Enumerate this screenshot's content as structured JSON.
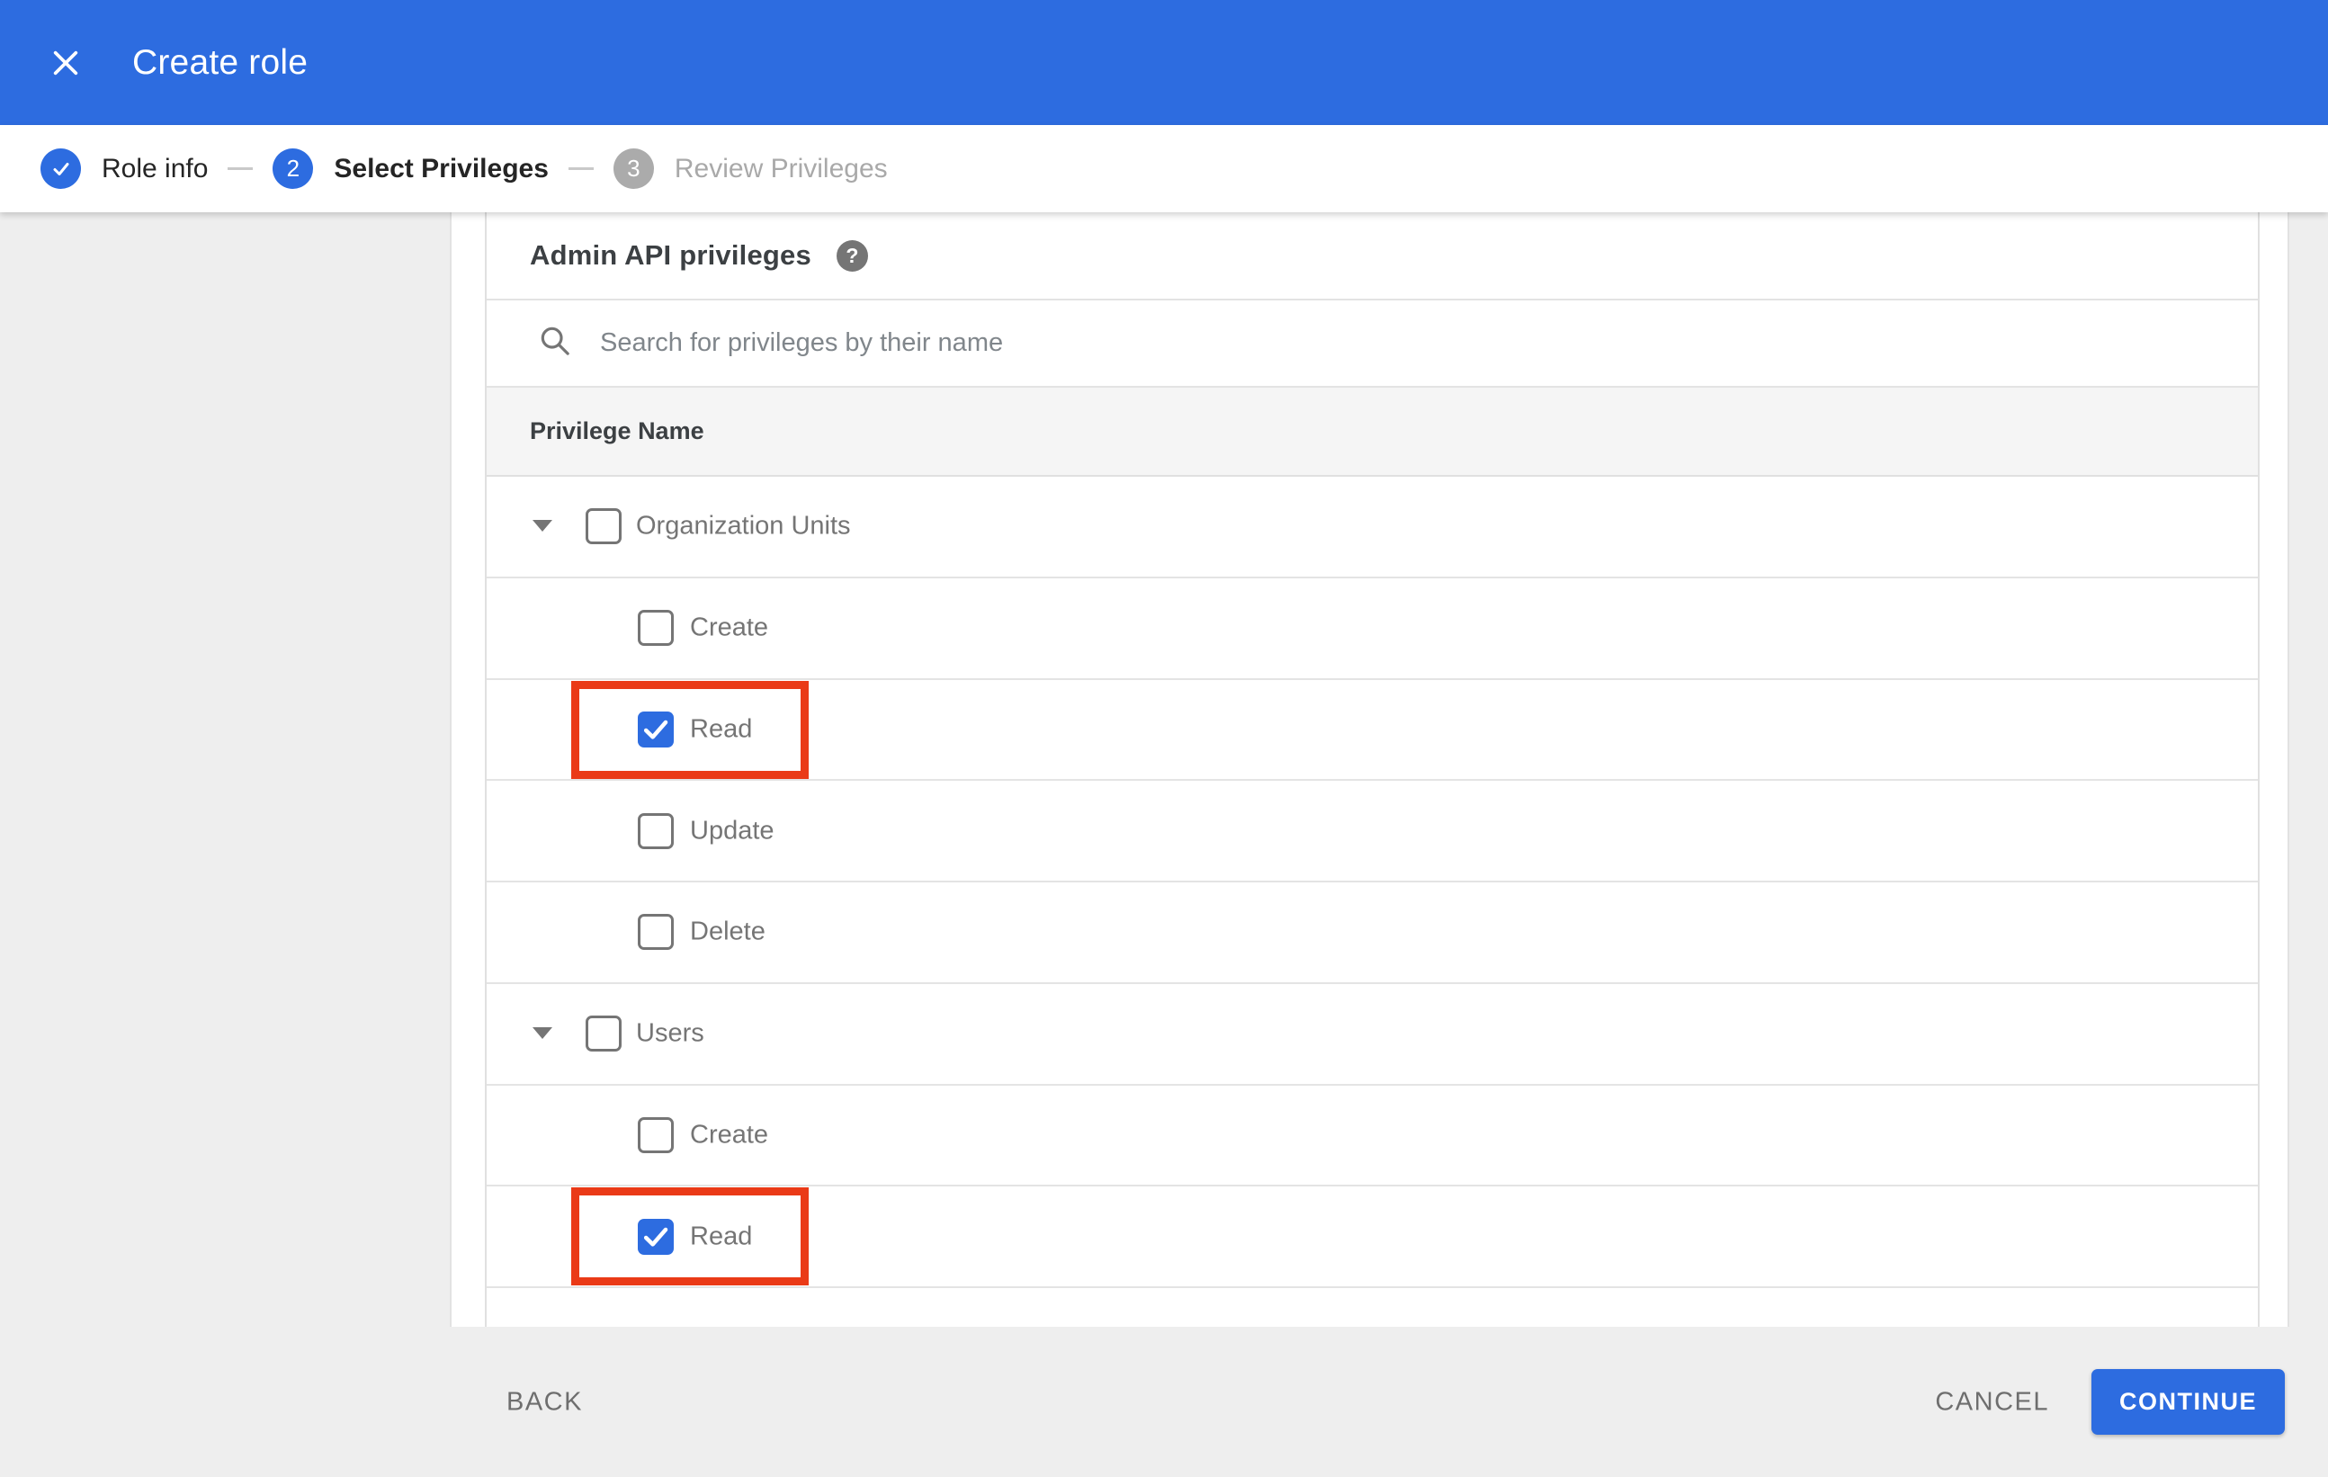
{
  "header": {
    "title": "Create role",
    "close_icon": "x"
  },
  "stepper": {
    "steps": [
      {
        "label": "Role info",
        "state": "complete",
        "indicator": "check"
      },
      {
        "label": "Select Privileges",
        "state": "current",
        "indicator": "2"
      },
      {
        "label": "Review Privileges",
        "state": "upcoming",
        "indicator": "3"
      }
    ]
  },
  "panel": {
    "title": "Admin API privileges",
    "help_glyph": "?",
    "search": {
      "placeholder": "Search for privileges by their name",
      "value": ""
    },
    "table": {
      "header_label": "Privilege Name",
      "rows": [
        {
          "label": "Organization Units",
          "level": 0,
          "expandable": true,
          "expanded": true,
          "checked": false,
          "highlighted": false
        },
        {
          "label": "Create",
          "level": 1,
          "expandable": false,
          "checked": false,
          "highlighted": false
        },
        {
          "label": "Read",
          "level": 1,
          "expandable": false,
          "checked": true,
          "highlighted": true
        },
        {
          "label": "Update",
          "level": 1,
          "expandable": false,
          "checked": false,
          "highlighted": false
        },
        {
          "label": "Delete",
          "level": 1,
          "expandable": false,
          "checked": false,
          "highlighted": false
        },
        {
          "label": "Users",
          "level": 0,
          "expandable": true,
          "expanded": true,
          "checked": false,
          "highlighted": false
        },
        {
          "label": "Create",
          "level": 1,
          "expandable": false,
          "checked": false,
          "highlighted": false
        },
        {
          "label": "Read",
          "level": 1,
          "expandable": false,
          "checked": true,
          "highlighted": true
        }
      ]
    }
  },
  "footer": {
    "back_label": "BACK",
    "cancel_label": "CANCEL",
    "continue_label": "CONTINUE"
  },
  "colors": {
    "header_blue": "#2d6ce0",
    "accent_blue": "#2d6ce0",
    "highlight_red": "#ea3a17",
    "page_gray": "#eeeeee",
    "table_header_gray": "#f5f5f5",
    "divider_gray": "#e3e3e3",
    "text_dark": "#3c4043",
    "text_gray": "#757575",
    "step_upcoming_gray": "#a9a9a9"
  }
}
